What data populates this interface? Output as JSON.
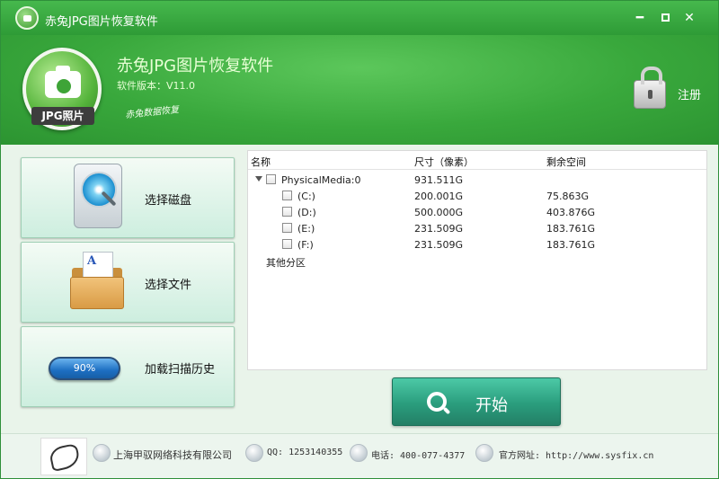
{
  "window": {
    "title": "赤兔JPG图片恢复软件",
    "min_glyph": "━",
    "close_glyph": "✕"
  },
  "header": {
    "app_name": "赤兔JPG图片恢复软件",
    "version": "软件版本：V11.0",
    "logo_label": "JPG照片",
    "tagline": "赤兔数据恢复",
    "register_label": "注册"
  },
  "sidebar": {
    "items": [
      {
        "label": "选择磁盘",
        "icon": "hard-disk-icon"
      },
      {
        "label": "选择文件",
        "icon": "folder-icon"
      },
      {
        "label": "加载扫描历史",
        "icon": "progress-pill-icon",
        "pill_text": "90%"
      }
    ]
  },
  "list": {
    "columns": [
      "名称",
      "尺寸（像素）",
      "剩余空间"
    ],
    "root": {
      "name": "PhysicalMedia:0",
      "size": "931.511G",
      "free": ""
    },
    "partitions": [
      {
        "name": "(C:)",
        "size": "200.001G",
        "free": "75.863G"
      },
      {
        "name": "(D:)",
        "size": "500.000G",
        "free": "403.876G"
      },
      {
        "name": "(E:)",
        "size": "231.509G",
        "free": "183.761G"
      },
      {
        "name": "(F:)",
        "size": "231.509G",
        "free": "183.761G"
      }
    ],
    "other": "其他分区"
  },
  "start_button": {
    "label": "开始"
  },
  "footer": {
    "company": "上海甲驭网络科技有限公司",
    "qq": "QQ: 1253140355",
    "phone": "电话: 400-077-4377",
    "website": "官方网址: http://www.sysfix.cn"
  },
  "colors": {
    "header_green": "#39a83c",
    "start_button": "#2a9d7d",
    "panel_bg": "#e9f4ea"
  }
}
